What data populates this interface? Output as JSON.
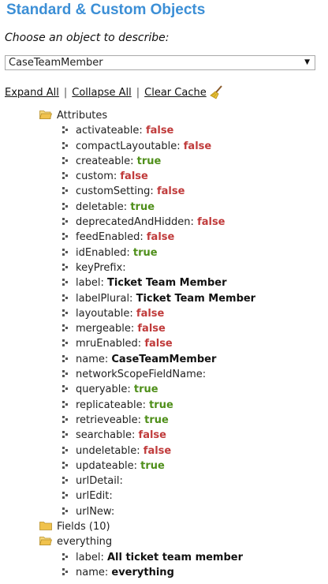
{
  "header": {
    "title": "Standard & Custom Objects"
  },
  "selector": {
    "prompt": "Choose an object to describe:",
    "selected": "CaseTeamMember"
  },
  "actions": {
    "expand_all": "Expand All",
    "collapse_all": "Collapse All",
    "clear_cache": "Clear Cache",
    "separator": "|"
  },
  "attributes": {
    "label": "Attributes",
    "items": [
      {
        "key": "activateable:",
        "value": "false",
        "type": "false"
      },
      {
        "key": "compactLayoutable:",
        "value": "false",
        "type": "false"
      },
      {
        "key": "createable:",
        "value": "true",
        "type": "true"
      },
      {
        "key": "custom:",
        "value": "false",
        "type": "false"
      },
      {
        "key": "customSetting:",
        "value": "false",
        "type": "false"
      },
      {
        "key": "deletable:",
        "value": "true",
        "type": "true"
      },
      {
        "key": "deprecatedAndHidden:",
        "value": "false",
        "type": "false"
      },
      {
        "key": "feedEnabled:",
        "value": "false",
        "type": "false"
      },
      {
        "key": "idEnabled:",
        "value": "true",
        "type": "true"
      },
      {
        "key": "keyPrefix:",
        "value": "",
        "type": "str"
      },
      {
        "key": "label:",
        "value": "Ticket Team Member",
        "type": "str"
      },
      {
        "key": "labelPlural:",
        "value": "Ticket Team Member",
        "type": "str"
      },
      {
        "key": "layoutable:",
        "value": "false",
        "type": "false"
      },
      {
        "key": "mergeable:",
        "value": "false",
        "type": "false"
      },
      {
        "key": "mruEnabled:",
        "value": "false",
        "type": "false"
      },
      {
        "key": "name:",
        "value": "CaseTeamMember",
        "type": "str"
      },
      {
        "key": "networkScopeFieldName:",
        "value": "",
        "type": "str"
      },
      {
        "key": "queryable:",
        "value": "true",
        "type": "true"
      },
      {
        "key": "replicateable:",
        "value": "true",
        "type": "true"
      },
      {
        "key": "retrieveable:",
        "value": "true",
        "type": "true"
      },
      {
        "key": "searchable:",
        "value": "false",
        "type": "false"
      },
      {
        "key": "undeletable:",
        "value": "false",
        "type": "false"
      },
      {
        "key": "updateable:",
        "value": "true",
        "type": "true"
      },
      {
        "key": "urlDetail:",
        "value": "",
        "type": "str"
      },
      {
        "key": "urlEdit:",
        "value": "",
        "type": "str"
      },
      {
        "key": "urlNew:",
        "value": "",
        "type": "str"
      }
    ]
  },
  "fields": {
    "label": "Fields (10)"
  },
  "everything": {
    "label": "everything",
    "items": [
      {
        "key": "label:",
        "value": "All ticket team member",
        "type": "str"
      },
      {
        "key": "name:",
        "value": "everything",
        "type": "str"
      }
    ]
  },
  "colors": {
    "title": "#3c8fd6",
    "true": "#4f8f1a",
    "false": "#c03b3b",
    "folder": "#e8b84a"
  },
  "icons": {
    "folder": "folder-icon",
    "open_folder": "folder-open-icon",
    "leaf": "node-icon",
    "broom": "broom-icon",
    "dropdown": "chevron-down-icon"
  }
}
